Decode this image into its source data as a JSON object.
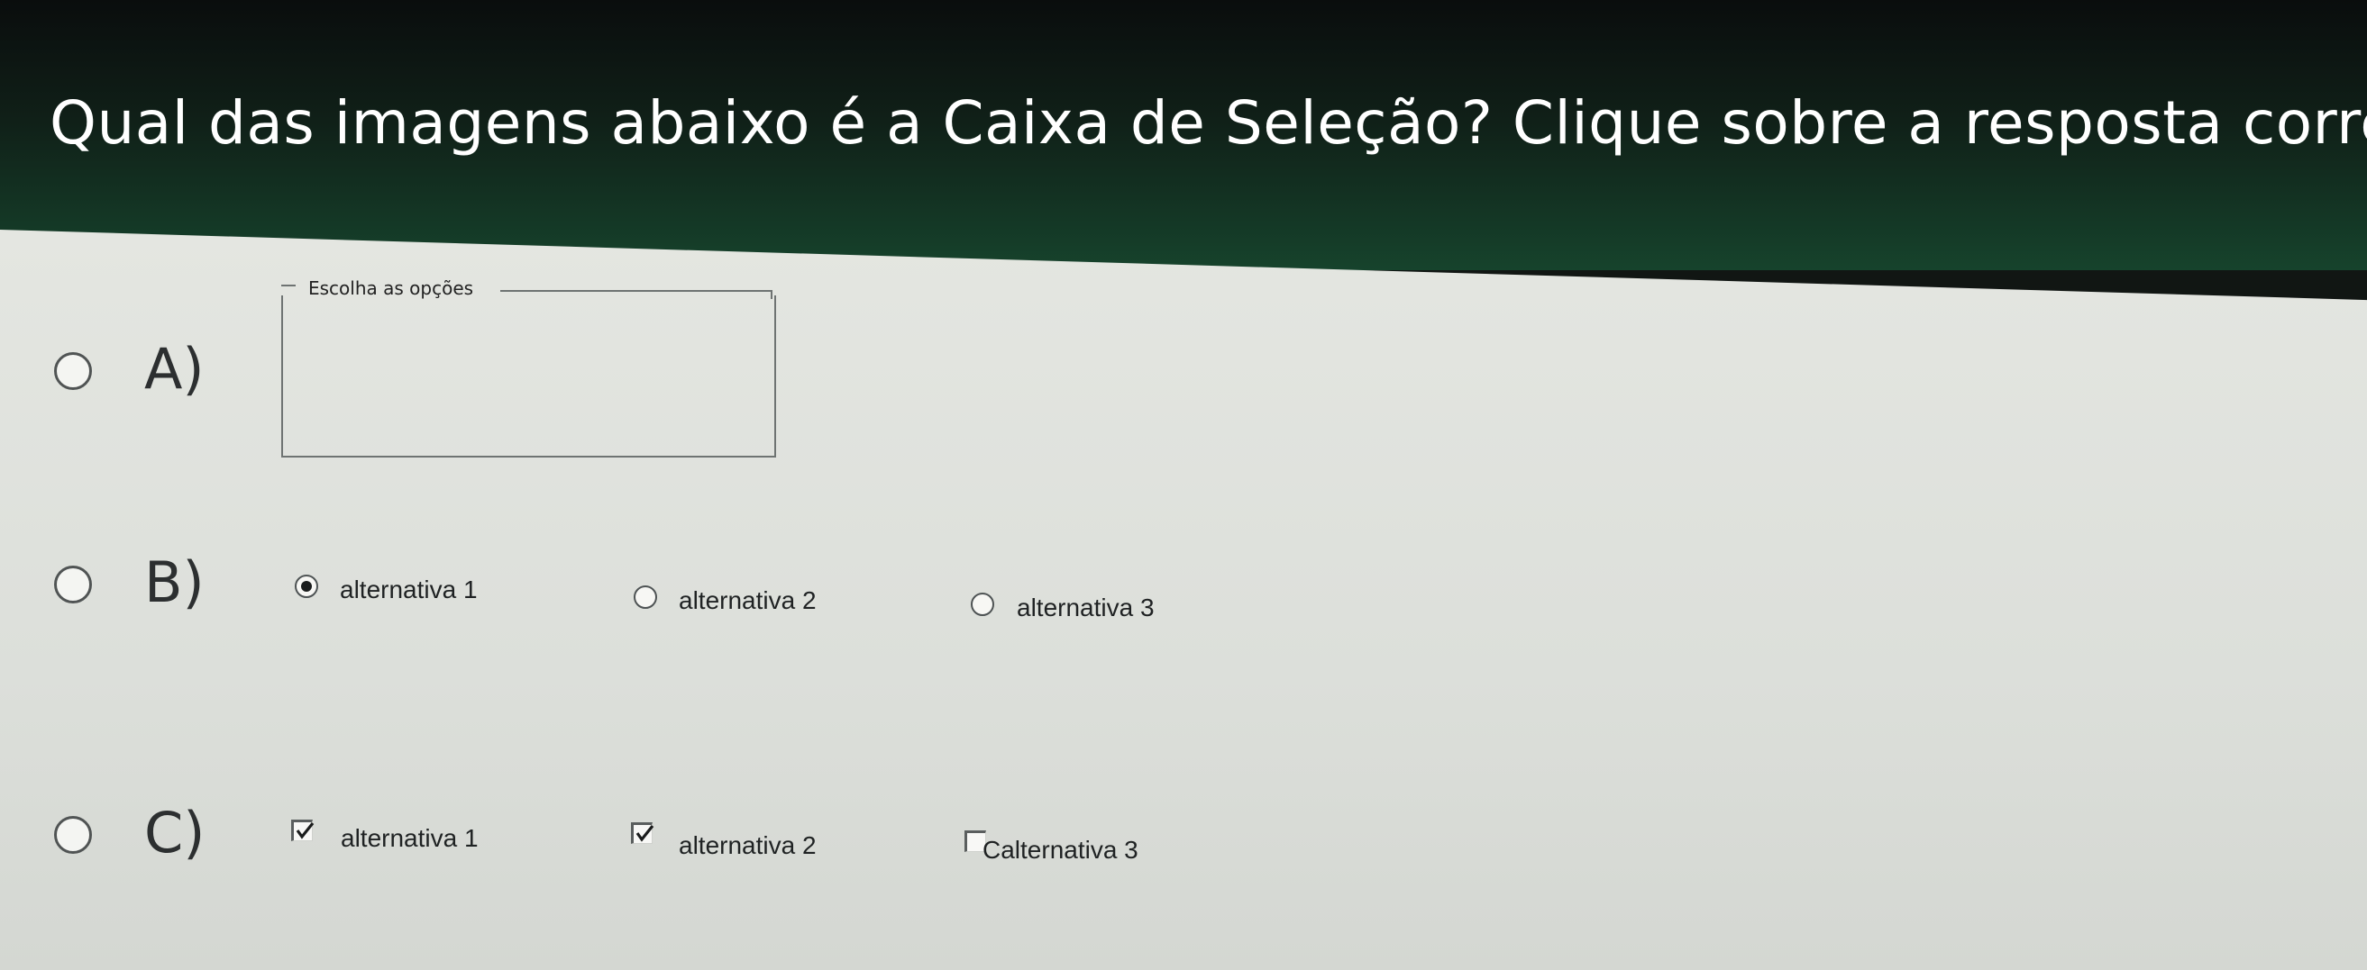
{
  "question": "Qual das imagens abaixo é a Caixa de Seleção? Clique sobre a resposta correta.",
  "options": [
    {
      "letter": "A)",
      "groupbox_label": "Escolha as opções"
    },
    {
      "letter": "B)",
      "radios": [
        {
          "label": "alternativa 1",
          "checked": true
        },
        {
          "label": "alternativa 2",
          "checked": false
        },
        {
          "label": "alternativa 3",
          "checked": false
        }
      ]
    },
    {
      "letter": "C)",
      "checkboxes": [
        {
          "label": "alternativa 1",
          "checked": true
        },
        {
          "label": "alternativa 2",
          "checked": true
        },
        {
          "label": "Calternativa 3",
          "checked": false
        }
      ]
    }
  ],
  "icons": {
    "radio": "radio-button-icon",
    "checkbox": "checkbox-icon",
    "check": "checkmark-icon"
  },
  "colors": {
    "header_top": "#0a0d0d",
    "header_bottom": "#16432c",
    "panel": "#dfe1dc",
    "text": "#1f2223"
  }
}
